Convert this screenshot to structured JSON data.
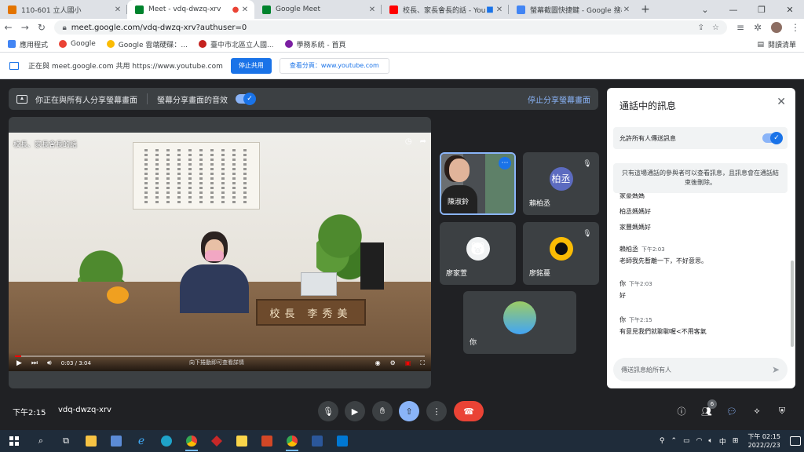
{
  "browser": {
    "tabs": [
      {
        "title": "110-601 立人國小",
        "icon_color": "#e37400",
        "active": false
      },
      {
        "title": "Meet - vdq-dwzq-xrv",
        "icon_color": "#00832d",
        "active": true
      },
      {
        "title": "Google Meet",
        "icon_color": "#00832d",
        "active": false
      },
      {
        "title": "校長、家長會長的話 - YouTube",
        "icon_color": "#ff0000",
        "active": false
      },
      {
        "title": "螢幕截圖快捷鍵 - Google 搜尋",
        "icon_color": "#4285f4",
        "active": false
      }
    ],
    "new_tab": "+",
    "url": "meet.google.com/vdq-dwzq-xrv?authuser=0",
    "bookmarks": [
      {
        "label": "應用程式",
        "icon_color": "#4285f4"
      },
      {
        "label": "Google",
        "icon_color": "#ea4335"
      },
      {
        "label": "Google 雲端硬碟：...",
        "icon_color": "#fbbc04"
      },
      {
        "label": "臺中市北區立人國...",
        "icon_color": "#c5221f"
      },
      {
        "label": "學務系統 - 首頁",
        "icon_color": "#7b1fa2"
      }
    ],
    "reading_list": "閱讀清單"
  },
  "infobar": {
    "message": "正在與 meet.google.com 共用 https://www.youtube.com",
    "stop_label": "停止共用",
    "view_label": "查看分頁：www.youtube.com"
  },
  "meet": {
    "share_banner": {
      "message": "你正在與所有人分享螢幕畫面",
      "audio_label": "螢幕分享畫面的音效",
      "stop_label": "停止分享螢幕畫面"
    },
    "video": {
      "title": "校長、家長會長的話",
      "time": "0:03 / 3:04",
      "hint": "向下捲動即可查看詳情",
      "progress": 0.016,
      "nameplate": "校長 李秀美"
    },
    "participants": [
      {
        "name": "陳淑鈴",
        "type": "camera",
        "speaking": true
      },
      {
        "name": "賴柏丞",
        "type": "initial",
        "initial": "柏丞",
        "color": "#5c6bc0",
        "muted": true
      },
      {
        "name": "廖家萱",
        "type": "avatar",
        "color": "#f1f3f4",
        "muted": false
      },
      {
        "name": "廖銘蔓",
        "type": "avatar",
        "color": "#fbbc04",
        "muted": true
      },
      {
        "name": "你",
        "type": "avatar",
        "color": "#c8e6c9",
        "muted": false
      }
    ],
    "chat": {
      "title": "通話中的訊息",
      "allow_label": "允許所有人傳送訊息",
      "notice": "只有這場通話的參與者可以查看訊息，且訊息會在通話結束後刪除。",
      "early_lines": [
        "家豪媽媽",
        "柏丞媽媽好",
        "家豐媽媽好"
      ],
      "messages": [
        {
          "sender": "賴柏丞",
          "time": "下午2:03",
          "text": "老師我先暫離一下，不好意思。"
        },
        {
          "sender": "你",
          "time": "下午2:03",
          "text": "好"
        },
        {
          "sender": "你",
          "time": "下午2:15",
          "text": "有意見我們就聊聊喔<不用客氣"
        }
      ],
      "input_placeholder": "傳送訊息給所有人"
    },
    "bottom": {
      "time": "下午2:15",
      "code": "vdq-dwzq-xrv",
      "people_count": "6"
    }
  },
  "taskbar": {
    "ime": "中",
    "clock_time": "下午 02:15",
    "clock_date": "2022/2/23"
  }
}
